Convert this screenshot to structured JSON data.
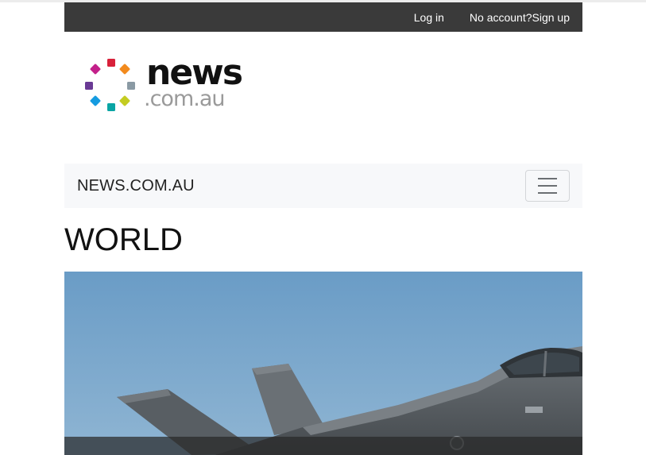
{
  "topbar": {
    "login_label": "Log in",
    "signup_label": "No account?Sign up"
  },
  "logo": {
    "word": "news",
    "domain": ".com.au",
    "dot_colors": [
      "#d8213a",
      "#f28a1d",
      "#8a9aa4",
      "#c4cc21",
      "#0aa5a4",
      "#159be0",
      "#6a3a95",
      "#c3208a"
    ]
  },
  "navbar": {
    "brand": "NEWS.COM.AU",
    "toggler_icon": "hamburger-icon"
  },
  "section": {
    "title": "WORLD"
  },
  "hero": {
    "image_subject": "fighter-jet",
    "caption": ""
  }
}
